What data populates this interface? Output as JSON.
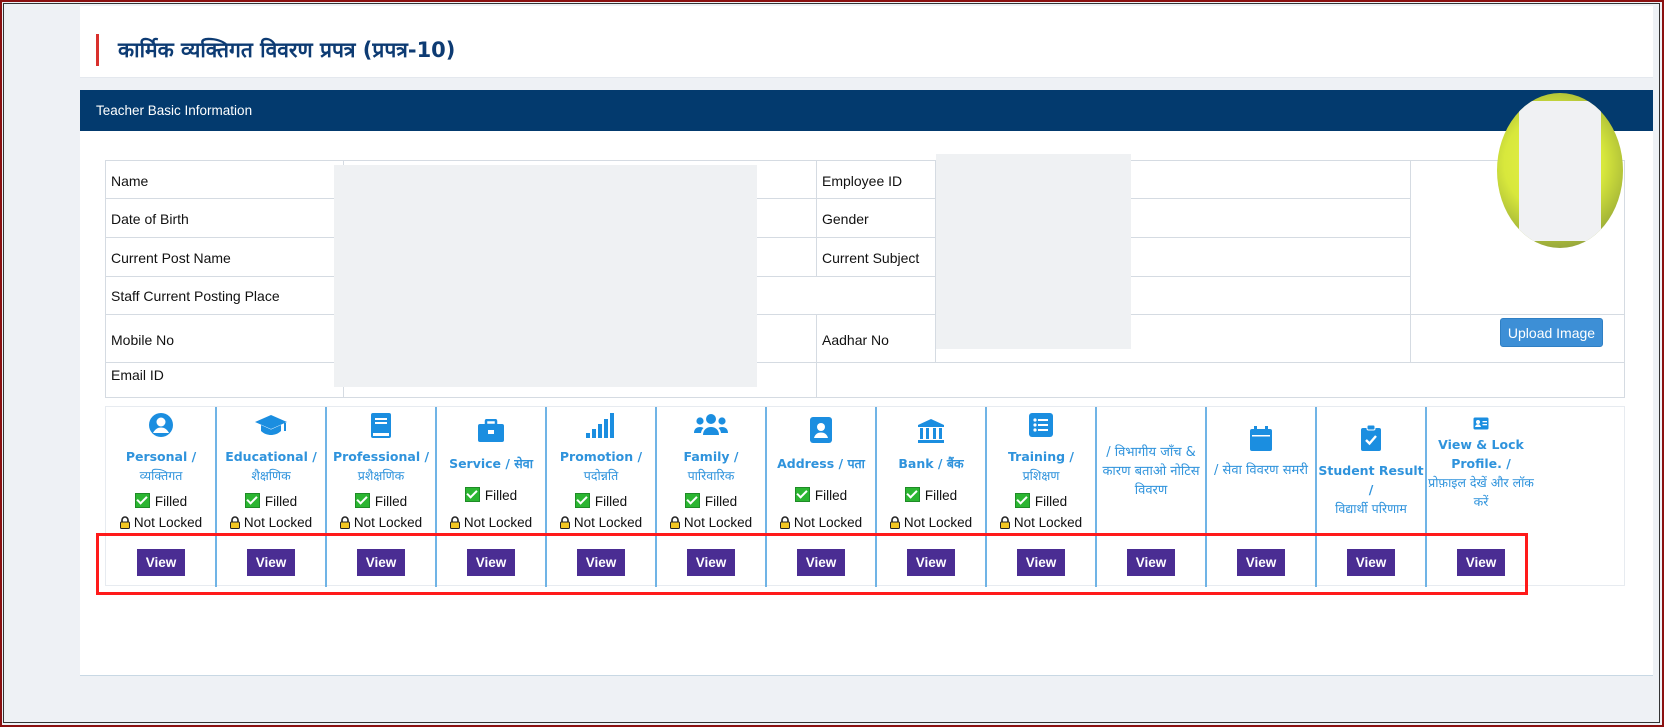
{
  "page": {
    "title": "कार्मिक व्यक्तिगत विवरण प्रपत्र (प्रपत्र-10)"
  },
  "card": {
    "header": "Teacher Basic Information"
  },
  "info": {
    "name_label": "Name",
    "dob_label": "Date of Birth",
    "post_label": "Current Post Name",
    "posting_label": "Staff Current Posting Place",
    "mobile_label": "Mobile No",
    "email_label": "Email ID",
    "empid_label": "Employee ID",
    "gender_label": "Gender",
    "subject_label": "Current Subject",
    "aadhar_label": "Aadhar No",
    "upload_label": "Upload Image"
  },
  "status": {
    "filled": "Filled",
    "not_locked": "Not Locked"
  },
  "view_label": "View",
  "modules": [
    {
      "title_en": "Personal /",
      "title_hi": "व्यक्तिगत",
      "icon": "user-circle-icon",
      "status": true
    },
    {
      "title_en": "Educational /",
      "title_hi": "शैक्षणिक",
      "icon": "graduation-cap-icon",
      "status": true
    },
    {
      "title_en": "Professional /",
      "title_hi": "प्रशैक्षणिक",
      "icon": "book-icon",
      "status": true
    },
    {
      "title_en": "Service / सेवा",
      "title_hi": "",
      "icon": "briefcase-icon",
      "status": true
    },
    {
      "title_en": "Promotion /",
      "title_hi": "पदोन्नति",
      "icon": "signal-bars-icon",
      "status": true
    },
    {
      "title_en": "Family /",
      "title_hi": "पारिवारिक",
      "icon": "users-icon",
      "status": true
    },
    {
      "title_en": "Address / पता",
      "title_hi": "",
      "icon": "address-book-icon",
      "status": true
    },
    {
      "title_en": "Bank / बैंक",
      "title_hi": "",
      "icon": "bank-icon",
      "status": true
    },
    {
      "title_en": "Training /",
      "title_hi": "प्रशिक्षण",
      "icon": "list-icon",
      "status": true
    },
    {
      "title_en": "/ विभागीय जाँच & कारण बताओ नोटिस विवरण",
      "title_hi": "",
      "icon": "",
      "status": false
    },
    {
      "title_en": "/ सेवा विवरण समरी",
      "title_hi": "",
      "icon": "calendar-icon",
      "status": false
    },
    {
      "title_en": "Student Result /",
      "title_hi": "विद्यार्थी परिणाम",
      "icon": "clipboard-check-icon",
      "status": false
    },
    {
      "title_en": "View & Lock Profile. /",
      "title_hi": "प्रोफ़ाइल देखें और लॉक करें",
      "icon": "id-card-icon",
      "status": false
    }
  ],
  "colors": {
    "header_bg": "#033a6e",
    "view_button": "#4a2d93",
    "module_text": "#2f93dc",
    "highlight_box": "#ff1a1a"
  }
}
